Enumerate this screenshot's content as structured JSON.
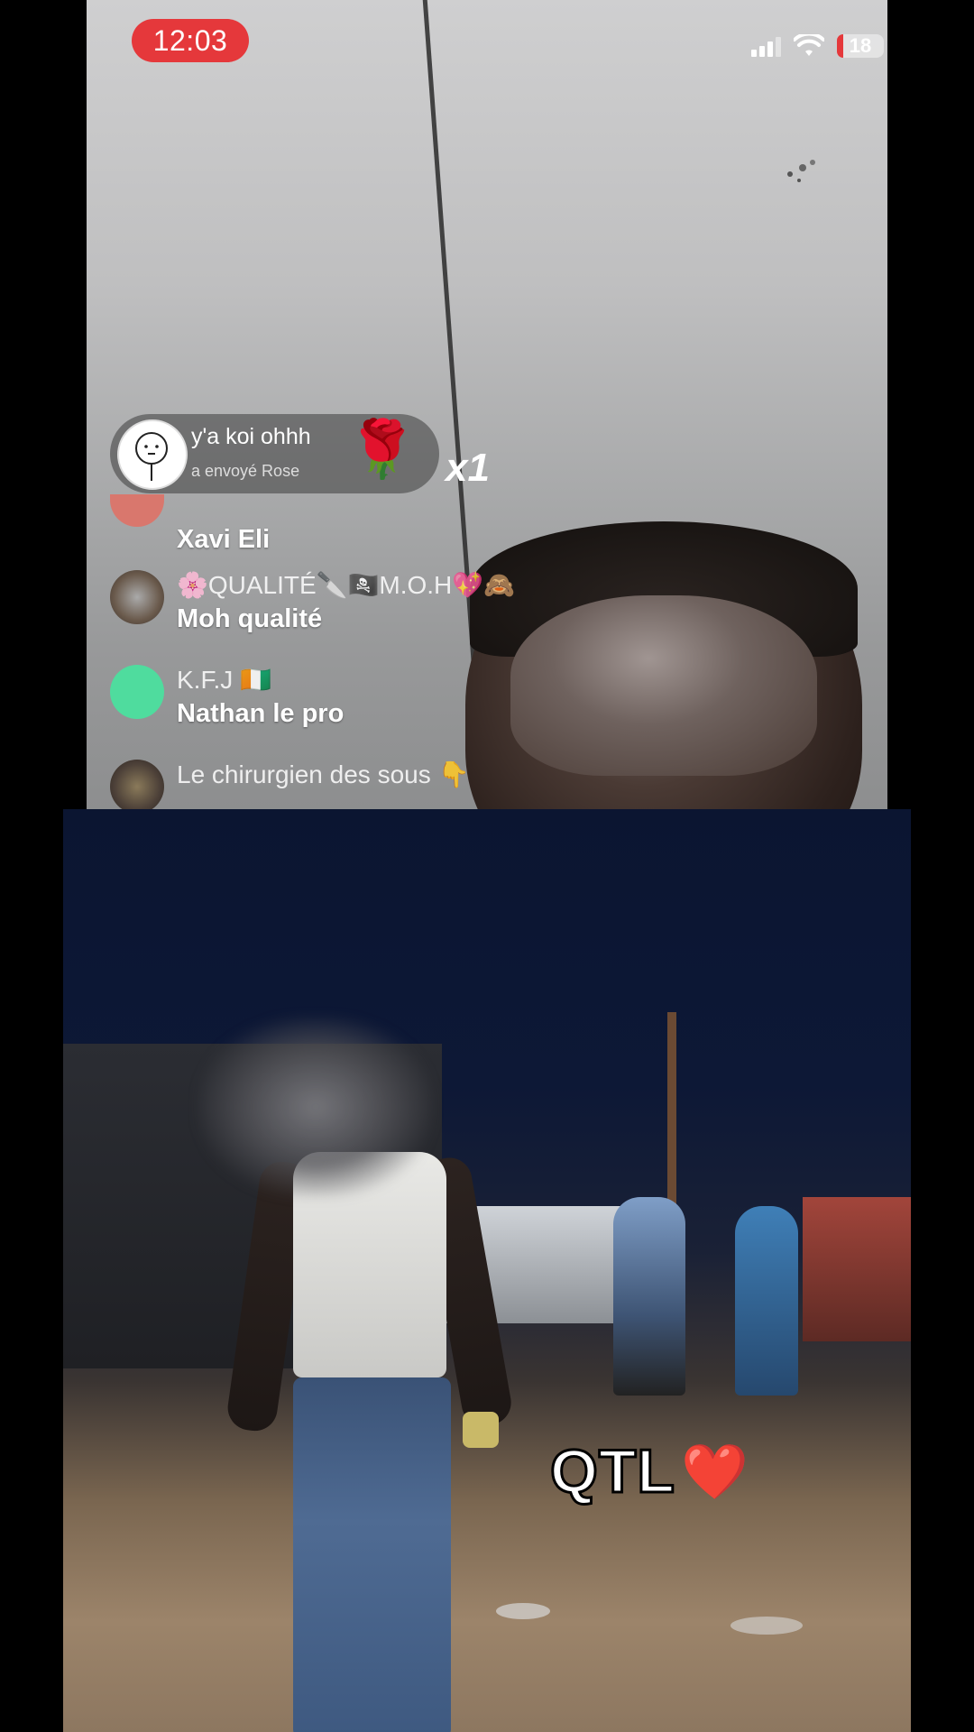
{
  "status_bar": {
    "time": "12:03",
    "battery": "18"
  },
  "gift": {
    "sender": "y'a koi ohhh",
    "action": "a envoyé  Rose",
    "icon": "🌹",
    "count": "x1"
  },
  "comments": [
    {
      "user": "",
      "message": "Xavi Eli",
      "avatar_color": "#d9776d"
    },
    {
      "user": "🌸QUALITÉ🔪🏴‍☠️M.O.H💖🙈",
      "message": "Moh qualité",
      "avatar_color": "#7a6a5c"
    },
    {
      "user": "K.F.J 🇨🇮",
      "message": "Nathan le pro",
      "avatar_color": "#4fdc9e"
    },
    {
      "user": "Le chirurgien des sous 👇",
      "message": "",
      "avatar_color": "#4c4038"
    }
  ],
  "video_caption": {
    "text": "QTL",
    "heart": "❤️"
  }
}
